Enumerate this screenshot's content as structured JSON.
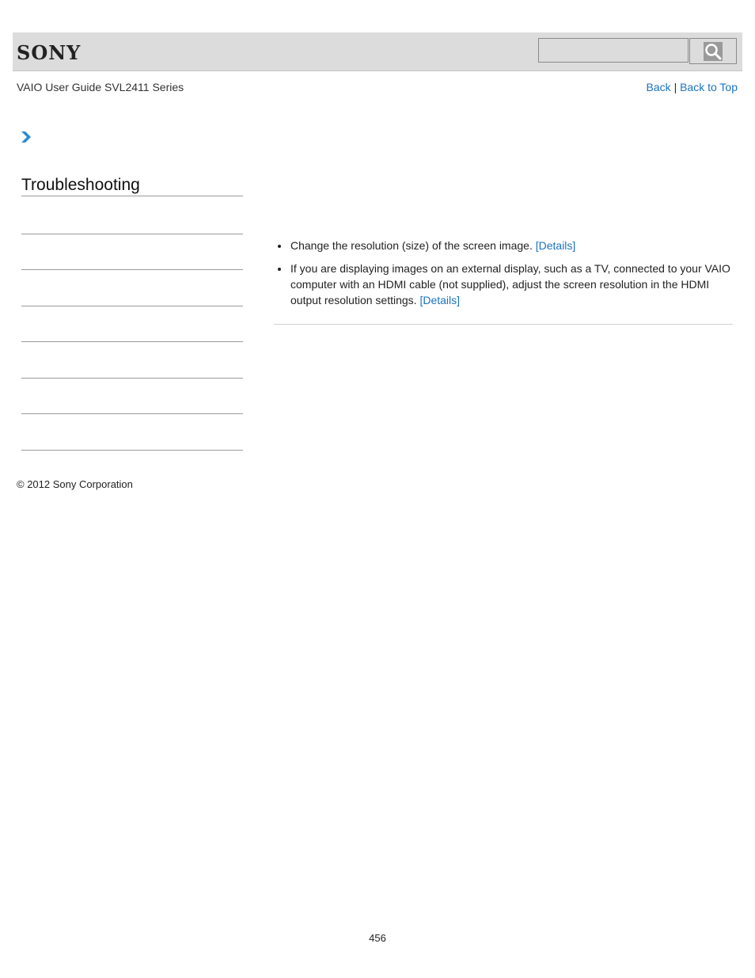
{
  "header": {
    "brand": "SONY",
    "search": {
      "placeholder": "",
      "value": "",
      "button_icon": "search-icon"
    }
  },
  "guide_title": "VAIO User Guide SVL2411 Series",
  "nav_links": {
    "back": "Back",
    "separator": "|",
    "back_to_top": "Back to Top"
  },
  "breadcrumb_icon": "chevron-right-icon",
  "sidebar": {
    "title": "Troubleshooting",
    "item_count": 7
  },
  "content": {
    "items": [
      {
        "text": "Change the resolution (size) of the screen image. ",
        "link": "[Details]"
      },
      {
        "text": "If you are displaying images on an external display, such as a TV, connected to your VAIO computer with an HDMI cable (not supplied), adjust the screen resolution in the HDMI output resolution settings. ",
        "link": "[Details]"
      }
    ]
  },
  "footer": {
    "copyright": "© 2012 Sony Corporation",
    "page_number": "456"
  },
  "colors": {
    "link": "#1a73c0",
    "header_bg": "#dcdcdc",
    "chevron": "#2a8ad4"
  }
}
